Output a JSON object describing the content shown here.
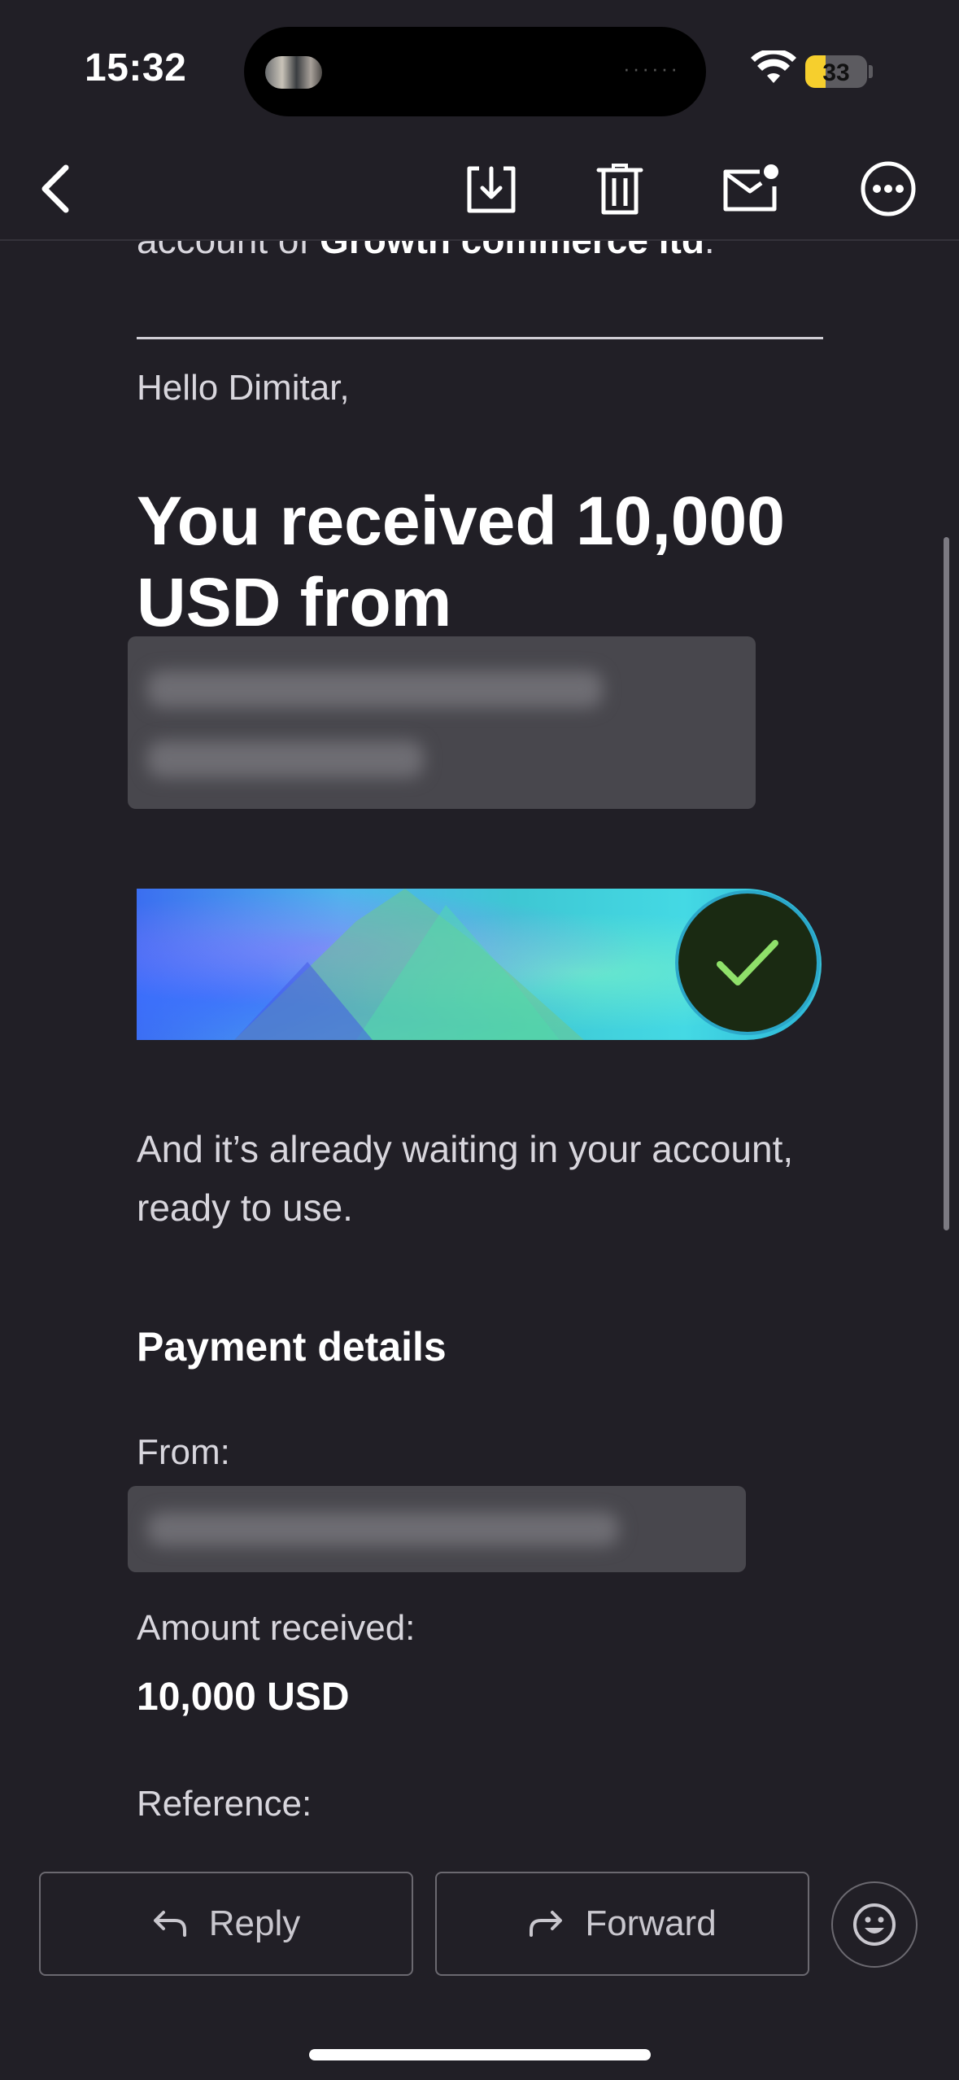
{
  "status_bar": {
    "time": "15:32",
    "battery": "33",
    "battery_percent": 33
  },
  "toolbar": {
    "back_icon": "chevron-left-icon",
    "archive_icon": "archive-tray-icon",
    "delete_icon": "trash-icon",
    "unread_icon": "mail-unread-icon",
    "more_icon": "ellipsis-circle-icon"
  },
  "email": {
    "cut_line_prefix": "account of ",
    "cut_line_company": "Growth commerce ltd",
    "cut_line_suffix": ".",
    "greeting": "Hello Dimitar,",
    "headline": "You received 10,000 USD from",
    "body": "And it’s already waiting in your account, ready to use.",
    "payment_details_title": "Payment details",
    "from_label": "From:",
    "amount_label": "Amount received:",
    "amount_value": "10,000 USD",
    "reference_label": "Reference:"
  },
  "actions": {
    "reply": "Reply",
    "forward": "Forward",
    "emoji_icon": "smiley-icon"
  },
  "colors": {
    "background": "#211f26",
    "check_green": "#8fe06a",
    "check_bg": "#1a2a12"
  }
}
